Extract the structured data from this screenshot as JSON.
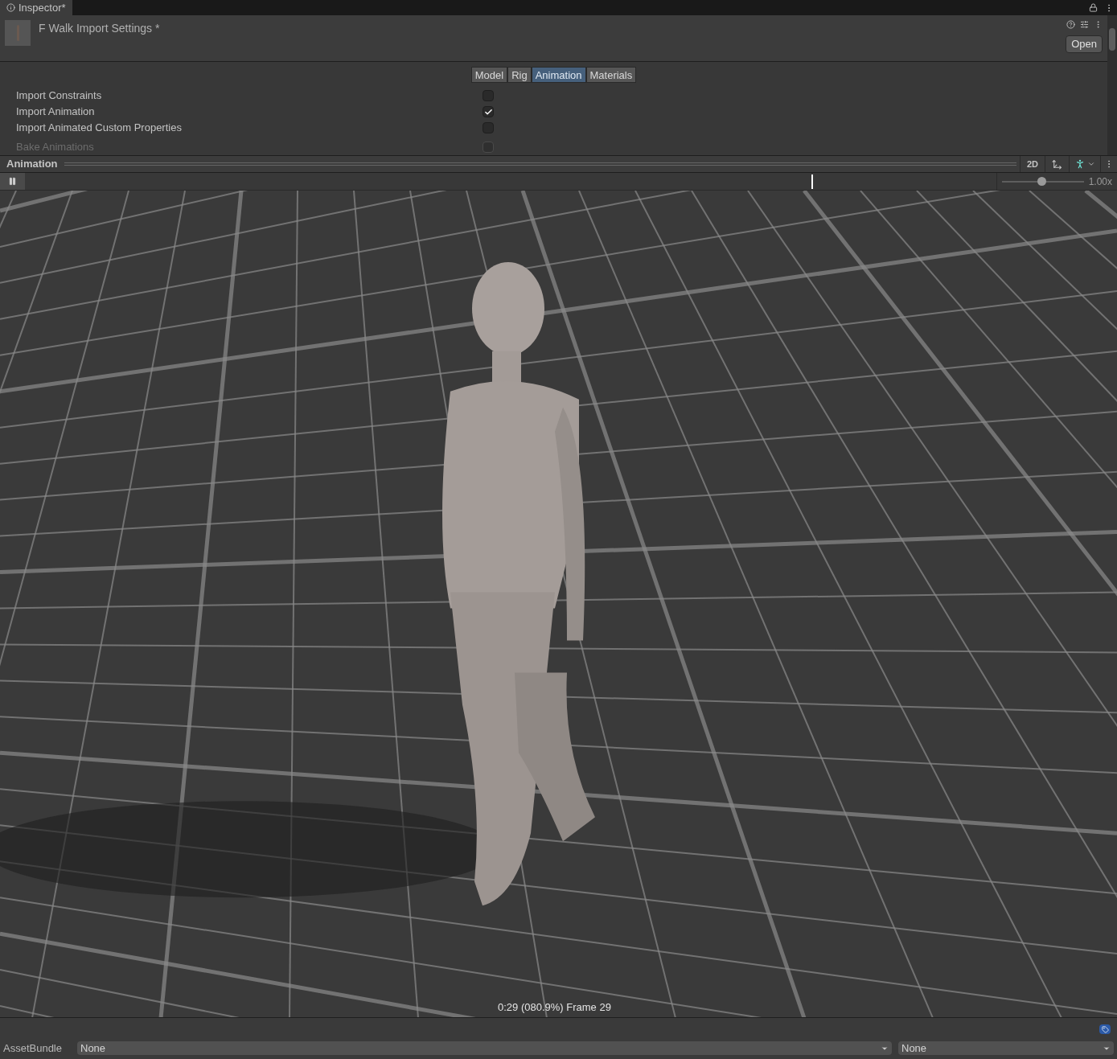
{
  "window": {
    "tab": "Inspector*"
  },
  "header": {
    "title": "F Walk Import Settings *",
    "open_button": "Open"
  },
  "tabs": [
    {
      "label": "Model",
      "selected": false
    },
    {
      "label": "Rig",
      "selected": false
    },
    {
      "label": "Animation",
      "selected": true
    },
    {
      "label": "Materials",
      "selected": false
    }
  ],
  "options": [
    {
      "label": "Import Constraints",
      "checked": false,
      "disabled": false
    },
    {
      "label": "Import Animation",
      "checked": true,
      "disabled": false
    },
    {
      "label": "Import Animated Custom Properties",
      "checked": false,
      "disabled": false
    },
    {
      "label": "Bake Animations",
      "checked": false,
      "disabled": true
    }
  ],
  "preview": {
    "title": "Animation",
    "mode_button": "2D",
    "playing": true,
    "timeline": {
      "level": 0.81
    },
    "speed": {
      "level": 0.48,
      "reading": "1.00x"
    },
    "caption": "0:29 (080.9%) Frame 29"
  },
  "asset_bundle": {
    "label": "AssetBundle",
    "name": "None",
    "variant": "None"
  }
}
